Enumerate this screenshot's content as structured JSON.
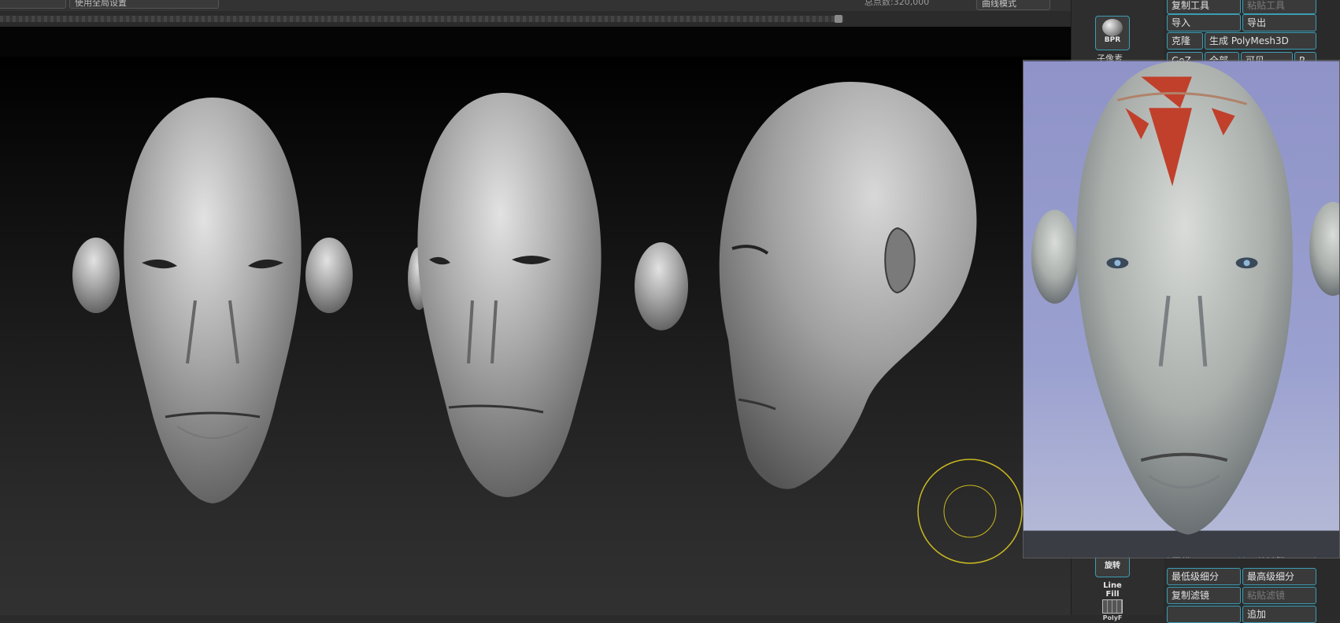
{
  "top_bar": {
    "btn_left": "",
    "btn_global": "使用全局设置",
    "total_vertices": "总点数:320,000",
    "curve_mode": "曲线模式"
  },
  "shelf": {
    "bpr": "BPR",
    "subtool_label": "子像素",
    "rotate": "旋转",
    "linefill": "Line Fill",
    "polyf": "PolyF"
  },
  "tool_panel": {
    "copy_tool": "复制工具",
    "paste_tool": "粘贴工具",
    "import": "导入",
    "export": "导出",
    "clone": "克隆",
    "make_polymesh": "生成 PolyMesh3D",
    "goz": "GoZ",
    "all": "全部",
    "visible": "可见",
    "r": "R",
    "row8_left": "重新...",
    "row8_right": "合并置换",
    "lowest_subdiv": "最低级细分",
    "highest_subdiv": "最高级细分",
    "copy_filter": "复制滤镜",
    "paste_filter": "粘贴滤镜",
    "add": "追加"
  },
  "colors": {
    "accent_border": "#3c9db4",
    "gyro": "#c9b820",
    "paint_red": "#c0402c",
    "sky": "#8f93c8"
  }
}
